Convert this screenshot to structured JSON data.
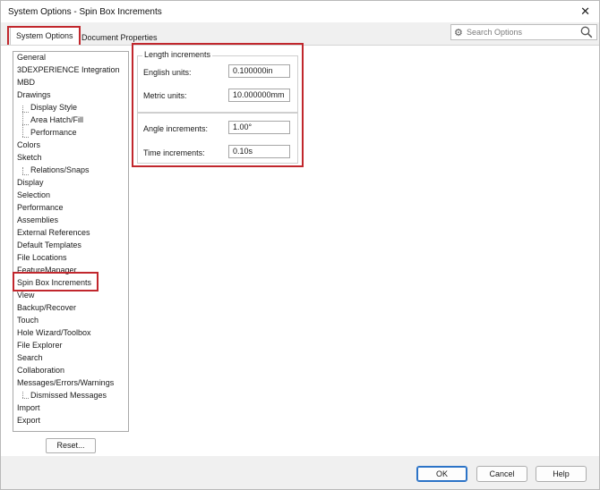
{
  "window": {
    "title": "System Options - Spin Box Increments",
    "close_glyph": "✕"
  },
  "tabs": {
    "system_options": "System Options",
    "document_properties": "Document Properties"
  },
  "search": {
    "placeholder": "Search Options",
    "icon_left": "gear-icon",
    "icon_right": "magnifier-icon"
  },
  "tree": {
    "items": [
      "General",
      "3DEXPERIENCE Integration",
      "MBD",
      "Drawings",
      "Display Style",
      "Area Hatch/Fill",
      "Performance",
      "Colors",
      "Sketch",
      "Relations/Snaps",
      "Display",
      "Selection",
      "Performance",
      "Assemblies",
      "External References",
      "Default Templates",
      "File Locations",
      "FeatureManager",
      "Spin Box Increments",
      "View",
      "Backup/Recover",
      "Touch",
      "Hole Wizard/Toolbox",
      "File Explorer",
      "Search",
      "Collaboration",
      "Messages/Errors/Warnings",
      "Dismissed Messages",
      "Import",
      "Export"
    ],
    "selected": "Spin Box Increments"
  },
  "reset_button": "Reset...",
  "length_increments": {
    "title": "Length increments",
    "english_label": "English units:",
    "english_value": "0.100000in",
    "metric_label": "Metric units:",
    "metric_value": "10.000000mm"
  },
  "other_increments": {
    "angle_label": "Angle increments:",
    "angle_value": "1.00°",
    "time_label": "Time increments:",
    "time_value": "0.10s"
  },
  "footer": {
    "ok": "OK",
    "cancel": "Cancel",
    "help": "Help"
  },
  "colors": {
    "highlight_red": "#c1272d",
    "ok_border_blue": "#2b73c7"
  }
}
